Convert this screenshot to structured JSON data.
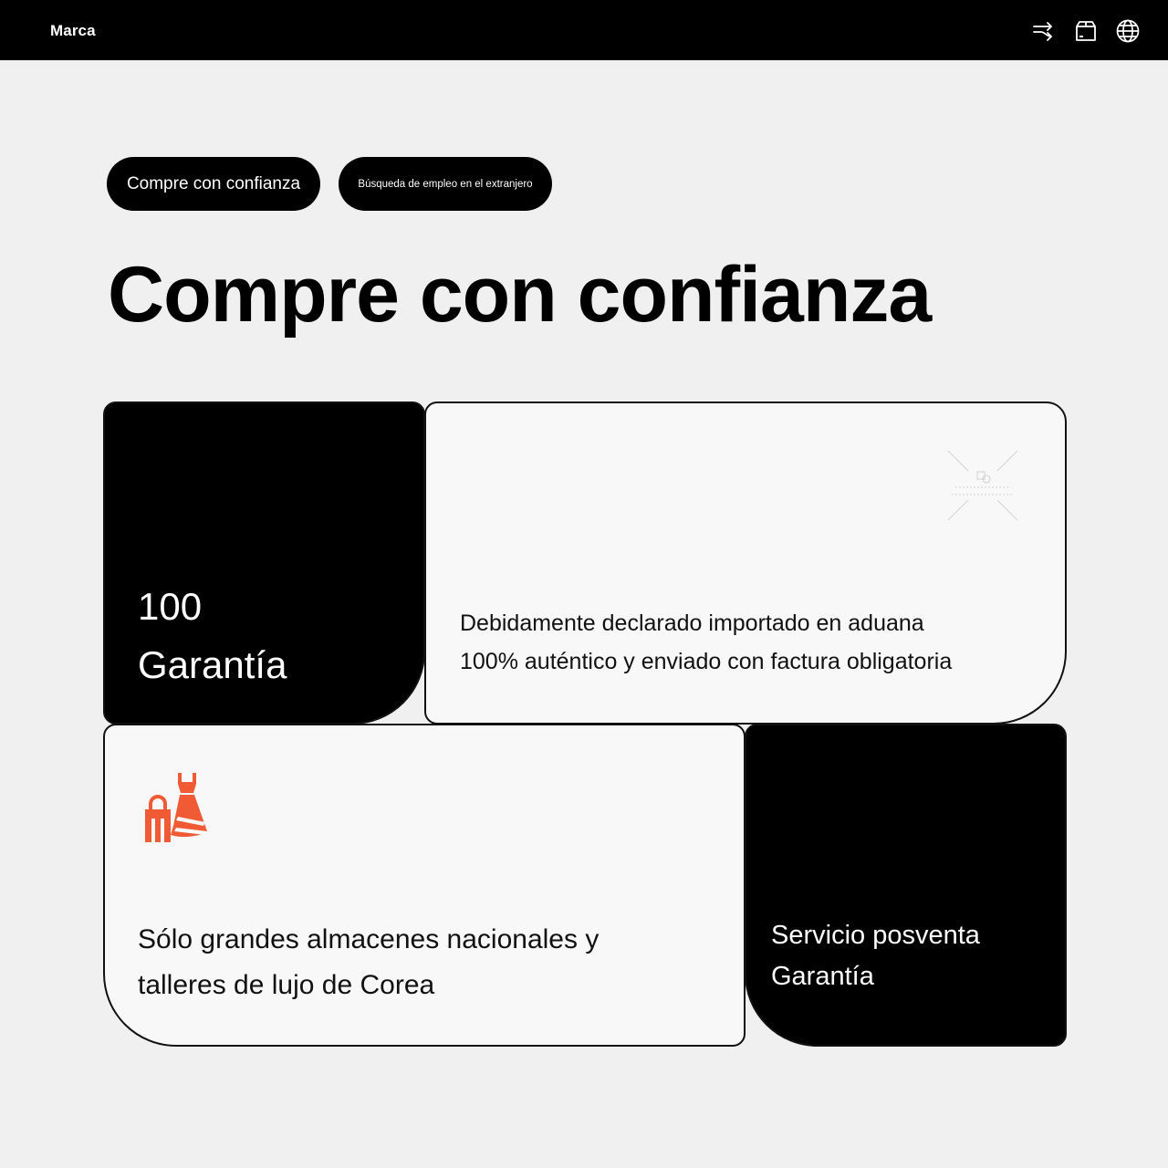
{
  "header": {
    "brand": "Marca",
    "icons": [
      "shuffle-icon",
      "package-icon",
      "globe-icon"
    ]
  },
  "tabs": [
    {
      "label": "Compre con confianza",
      "active": true
    },
    {
      "label": "Búsqueda de empleo en el extranjero",
      "active": false
    }
  ],
  "page_title": "Compre con confianza",
  "cards": {
    "guarantee": {
      "number": "100",
      "label": "Garantía"
    },
    "customs": {
      "line1": "Debidamente declarado importado en aduana",
      "line2": "100% auténtico y enviado con factura obligatoria",
      "watermark_icon": "copy-icon"
    },
    "stores": {
      "icon": "fashion-shopping-icon",
      "line1": "Sólo grandes almacenes nacionales y",
      "line2": "talleres de lujo de Corea"
    },
    "aftersales": {
      "line1": "Servicio posventa",
      "line2": "Garantía"
    }
  },
  "colors": {
    "header_bg": "#000000",
    "page_bg": "#f0f0f0",
    "card_white": "#f8f8f8",
    "accent": "#f05a35"
  }
}
